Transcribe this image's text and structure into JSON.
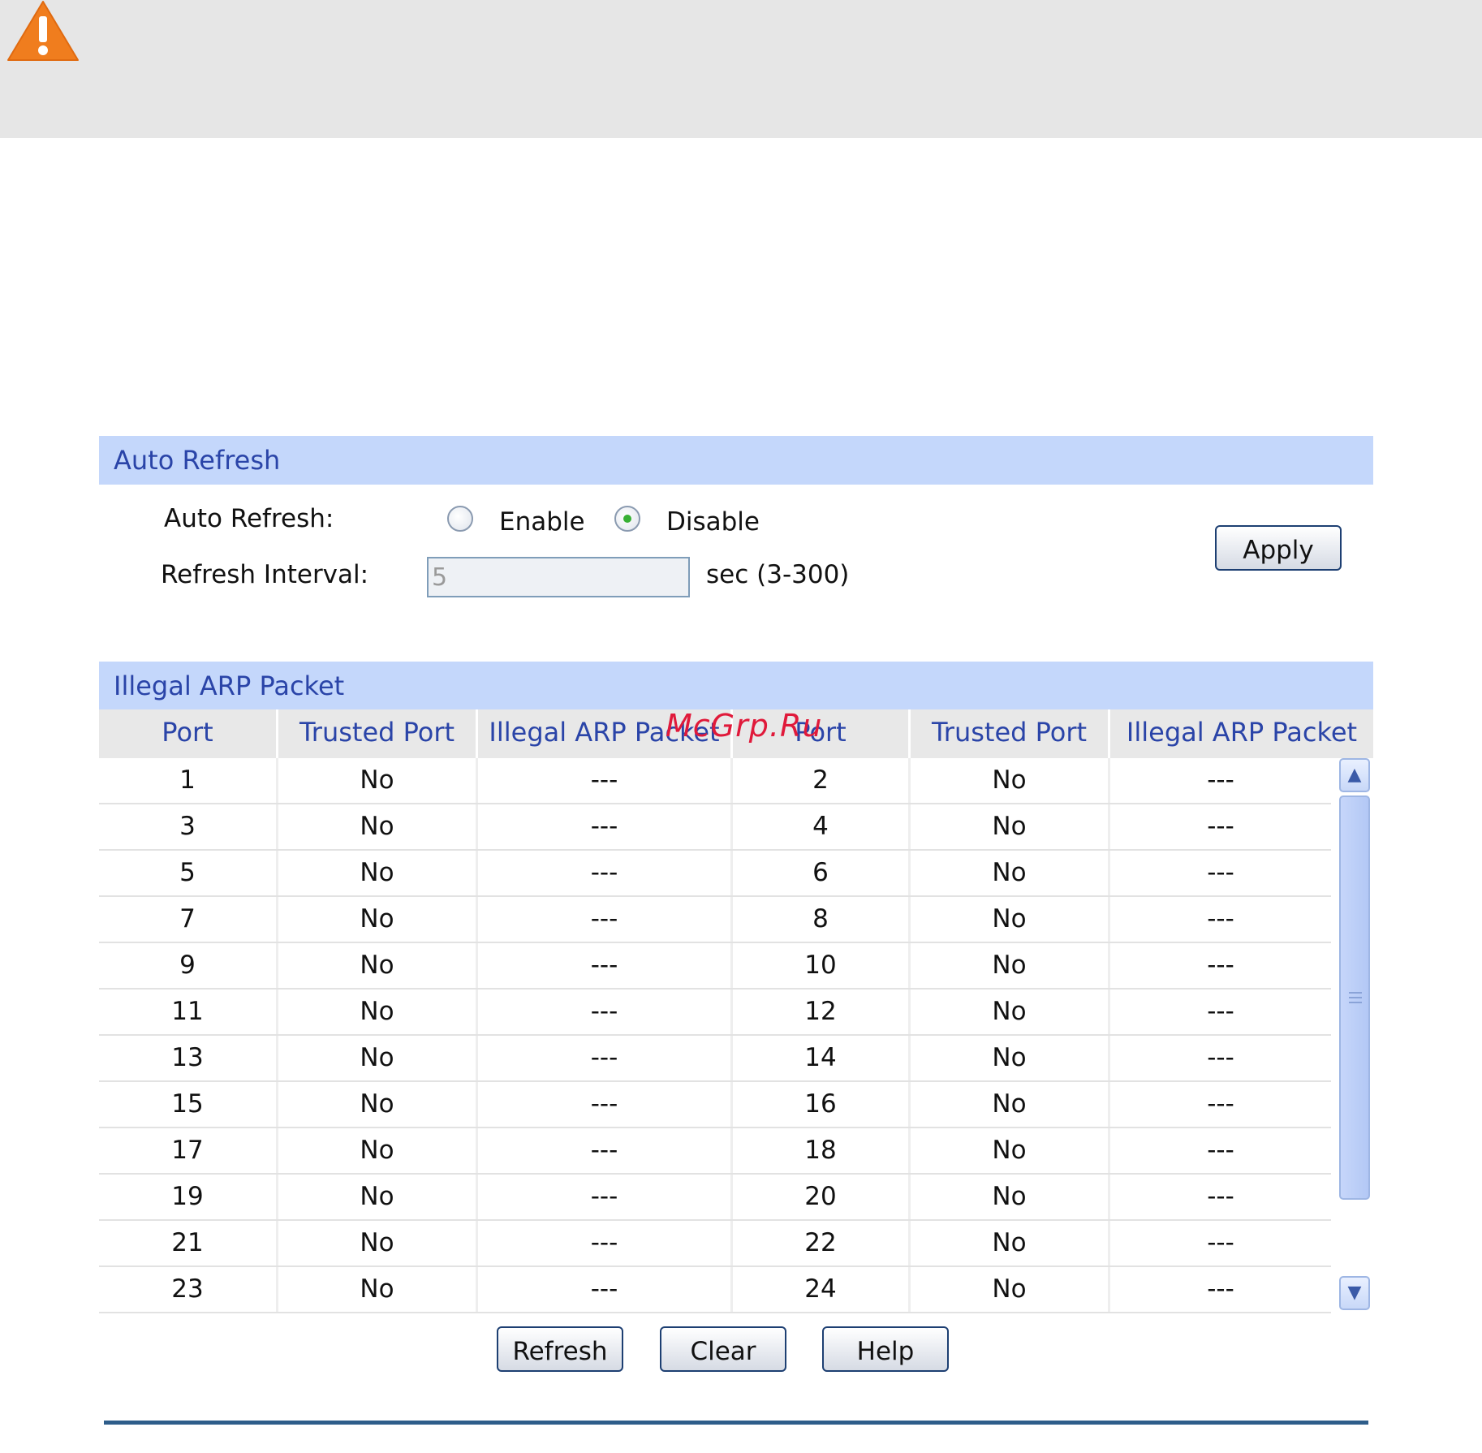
{
  "auto_refresh": {
    "header": "Auto Refresh",
    "label": "Auto Refresh:",
    "options": [
      {
        "label": "Enable",
        "checked": false
      },
      {
        "label": "Disable",
        "checked": true
      }
    ],
    "interval_label": "Refresh Interval:",
    "interval_value": "5",
    "interval_hint": "sec (3-300)",
    "apply_label": "Apply"
  },
  "illegal_arp": {
    "header": "Illegal ARP Packet",
    "columns": [
      "Port",
      "Trusted Port",
      "Illegal ARP Packet",
      "Port",
      "Trusted Port",
      "Illegal ARP Packet"
    ],
    "rows": [
      [
        "1",
        "No",
        "---",
        "2",
        "No",
        "---"
      ],
      [
        "3",
        "No",
        "---",
        "4",
        "No",
        "---"
      ],
      [
        "5",
        "No",
        "---",
        "6",
        "No",
        "---"
      ],
      [
        "7",
        "No",
        "---",
        "8",
        "No",
        "---"
      ],
      [
        "9",
        "No",
        "---",
        "10",
        "No",
        "---"
      ],
      [
        "11",
        "No",
        "---",
        "12",
        "No",
        "---"
      ],
      [
        "13",
        "No",
        "---",
        "14",
        "No",
        "---"
      ],
      [
        "15",
        "No",
        "---",
        "16",
        "No",
        "---"
      ],
      [
        "17",
        "No",
        "---",
        "18",
        "No",
        "---"
      ],
      [
        "19",
        "No",
        "---",
        "20",
        "No",
        "---"
      ],
      [
        "21",
        "No",
        "---",
        "22",
        "No",
        "---"
      ],
      [
        "23",
        "No",
        "---",
        "24",
        "No",
        "---"
      ]
    ]
  },
  "buttons": {
    "refresh": "Refresh",
    "clear": "Clear",
    "help": "Help"
  },
  "watermark": "McGrp.Ru",
  "icons": {
    "warning": "warning-icon",
    "scroll_up": "chevron-up-icon",
    "scroll_down": "chevron-down-icon"
  },
  "colors": {
    "panel_header_bg": "#c4d7fb",
    "header_text": "#2a44a8",
    "warning": "#f07d1e"
  }
}
